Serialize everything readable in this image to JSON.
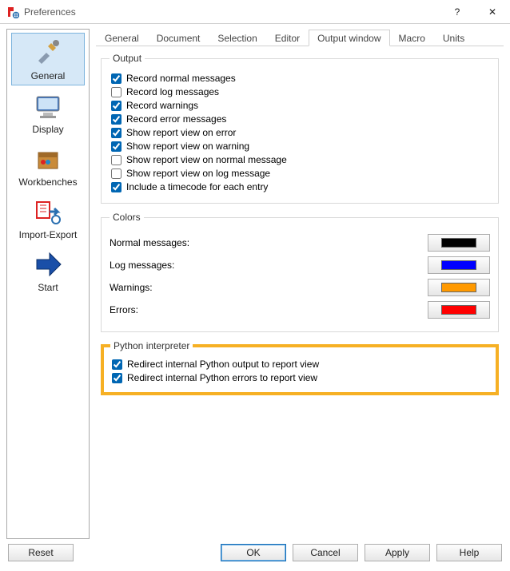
{
  "window": {
    "title": "Preferences",
    "help": "?",
    "close": "✕"
  },
  "sidebar": {
    "items": [
      {
        "label": "General",
        "icon": "tools"
      },
      {
        "label": "Display",
        "icon": "monitor"
      },
      {
        "label": "Workbenches",
        "icon": "box"
      },
      {
        "label": "Import-Export",
        "icon": "import-export"
      },
      {
        "label": "Start",
        "icon": "arrow"
      }
    ]
  },
  "tabs": [
    "General",
    "Document",
    "Selection",
    "Editor",
    "Output window",
    "Macro",
    "Units"
  ],
  "active_tab": "Output window",
  "output": {
    "legend": "Output",
    "items": [
      {
        "label": "Record normal messages",
        "checked": true
      },
      {
        "label": "Record log messages",
        "checked": false
      },
      {
        "label": "Record warnings",
        "checked": true
      },
      {
        "label": "Record error messages",
        "checked": true
      },
      {
        "label": "Show report view on error",
        "checked": true
      },
      {
        "label": "Show report view on warning",
        "checked": true
      },
      {
        "label": "Show report view on normal message",
        "checked": false
      },
      {
        "label": "Show report view on log message",
        "checked": false
      },
      {
        "label": "Include a timecode for each entry",
        "checked": true
      }
    ]
  },
  "colors": {
    "legend": "Colors",
    "rows": [
      {
        "label": "Normal messages:",
        "color": "#000000"
      },
      {
        "label": "Log messages:",
        "color": "#0000ff"
      },
      {
        "label": "Warnings:",
        "color": "#ff9900"
      },
      {
        "label": "Errors:",
        "color": "#ff0000"
      }
    ]
  },
  "python": {
    "legend": "Python interpreter",
    "items": [
      {
        "label": "Redirect internal Python output to report view",
        "checked": true
      },
      {
        "label": "Redirect internal Python errors to report view",
        "checked": true
      }
    ]
  },
  "footer": {
    "reset": "Reset",
    "ok": "OK",
    "cancel": "Cancel",
    "apply": "Apply",
    "help": "Help"
  }
}
